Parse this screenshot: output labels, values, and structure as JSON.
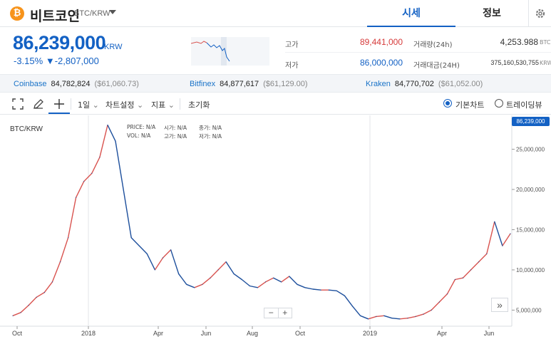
{
  "header": {
    "coin_icon_glyph": "₿",
    "coin_name": "비트코인",
    "pair": "BTC/KRW",
    "tabs": [
      {
        "label": "시세"
      },
      {
        "label": "정보"
      }
    ]
  },
  "price": {
    "current": "86,239,000",
    "unit": "KRW",
    "change_pct": "-3.15%",
    "change_abs": "▼-2,807,000"
  },
  "stats": {
    "high_label": "고가",
    "high_value": "89,441,000",
    "low_label": "저가",
    "low_value": "86,000,000",
    "vol_label": "거래량(24h)",
    "vol_value": "4,253.988",
    "vol_unit": "BTC",
    "amount_label": "거래대금(24H)",
    "amount_value": "375,160,530,755",
    "amount_unit": "KRW"
  },
  "exchanges": [
    {
      "name": "Coinbase",
      "price": "84,782,824",
      "usd": "($61,060.73)"
    },
    {
      "name": "Bitfinex",
      "price": "84,877,617",
      "usd": "($61,129.00)"
    },
    {
      "name": "Kraken",
      "price": "84,770,702",
      "usd": "($61,052.00)"
    }
  ],
  "toolbar": {
    "interval": "1일",
    "chart_settings": "차트설정",
    "indicators": "지표",
    "reset": "초기화",
    "basic_chart": "기본차트",
    "tradingview": "트레이딩뷰"
  },
  "chart": {
    "title": "BTC/KRW",
    "last_price_tag": "86,239,000",
    "legend": {
      "price_label": "PRICE:",
      "price_val": "N/A",
      "open_label": "시가:",
      "open_val": "N/A",
      "close_label": "종가:",
      "close_val": "N/A",
      "vol_label": "VOL:",
      "vol_val": "N/A",
      "high_label": "고가:",
      "high_val": "N/A",
      "low_label": "저가:",
      "low_val": "N/A"
    },
    "zoom_minus": "−",
    "zoom_plus": "+",
    "scroll_glyph": "»"
  },
  "chart_data": {
    "type": "line",
    "title": "BTC/KRW",
    "x_ticks": [
      "Oct",
      "2018",
      "Apr",
      "Jun",
      "Aug",
      "Oct",
      "2019",
      "Apr",
      "Jun"
    ],
    "y_ticks": [
      5000000,
      10000000,
      15000000,
      20000000,
      25000000
    ],
    "y_tick_labels": [
      "5,000,000",
      "10,000,000",
      "15,000,000",
      "20,000,000",
      "25,000,000"
    ],
    "ylim": [
      3000000,
      28500000
    ],
    "series": [
      {
        "values": [
          4300000,
          4700000,
          5600000,
          6600000,
          7200000,
          8500000,
          11000000,
          14000000,
          19000000,
          21000000,
          22000000,
          24000000,
          28000000,
          26000000,
          20000000,
          14000000,
          13000000,
          12000000,
          10000000,
          11500000,
          12500000,
          9500000,
          8200000,
          7800000,
          8200000,
          9000000,
          10000000,
          11000000,
          9500000,
          8800000,
          8000000,
          7800000,
          8500000,
          9000000,
          8500000,
          9200000,
          8200000,
          7800000,
          7600000,
          7500000,
          7500000,
          7400000,
          6800000,
          5500000,
          4300000,
          3900000,
          4200000,
          4300000,
          4000000,
          3900000,
          4000000,
          4200000,
          4500000,
          5000000,
          6000000,
          7000000,
          8800000,
          9000000,
          10000000,
          11000000,
          12000000,
          16000000,
          13000000,
          14500000
        ]
      }
    ]
  }
}
